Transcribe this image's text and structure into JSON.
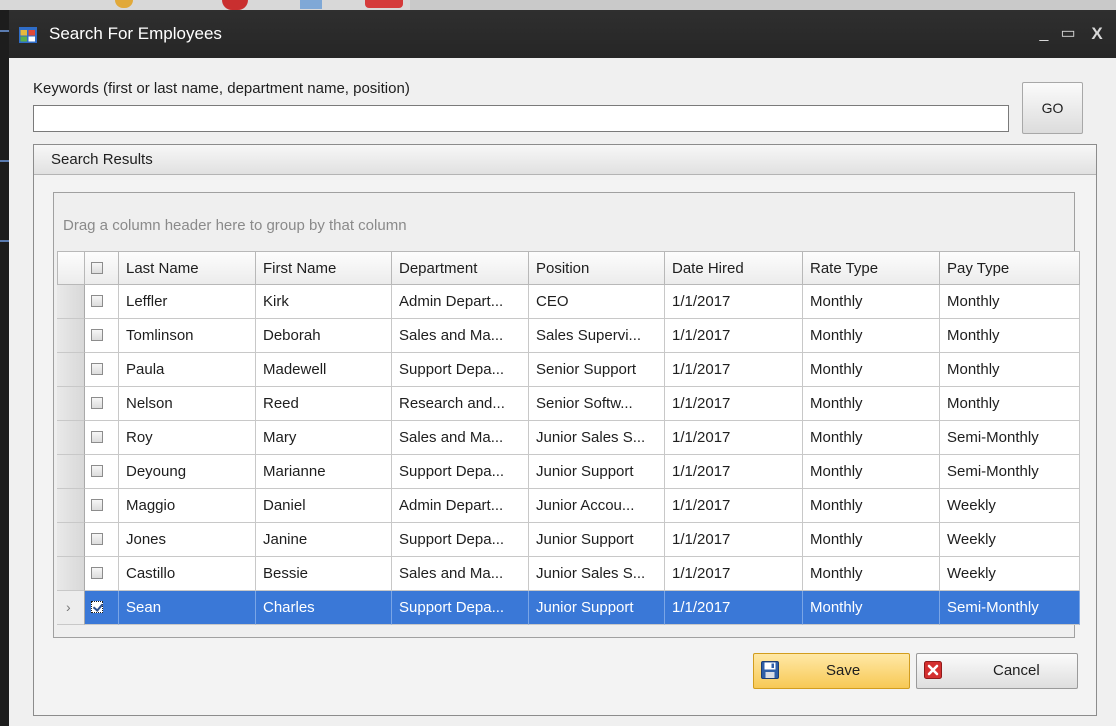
{
  "window": {
    "title": "Search For Employees",
    "controls": {
      "minimize": "_",
      "maximize": "▭",
      "close": "X"
    }
  },
  "search": {
    "label": "Keywords (first or last name, department name, position)",
    "value": "",
    "placeholder": "",
    "go_label": "GO"
  },
  "results": {
    "group_title": "Search Results",
    "group_hint": "Drag a column header here to group by that column",
    "columns": [
      "Last Name",
      "First Name",
      "Department",
      "Position",
      "Date Hired",
      "Rate Type",
      "Pay Type"
    ],
    "rows": [
      {
        "checked": false,
        "selected": false,
        "cells": [
          "Leffler",
          "Kirk",
          "Admin Depart...",
          "CEO",
          "1/1/2017",
          "Monthly",
          "Monthly"
        ]
      },
      {
        "checked": false,
        "selected": false,
        "cells": [
          "Tomlinson",
          "Deborah",
          "Sales and Ma...",
          "Sales Supervi...",
          "1/1/2017",
          "Monthly",
          "Monthly"
        ]
      },
      {
        "checked": false,
        "selected": false,
        "cells": [
          "Paula",
          "Madewell",
          "Support Depa...",
          "Senior Support",
          "1/1/2017",
          "Monthly",
          "Monthly"
        ]
      },
      {
        "checked": false,
        "selected": false,
        "cells": [
          "Nelson",
          "Reed",
          "Research and...",
          "Senior Softw...",
          "1/1/2017",
          "Monthly",
          "Monthly"
        ]
      },
      {
        "checked": false,
        "selected": false,
        "cells": [
          "Roy",
          "Mary",
          "Sales and Ma...",
          "Junior Sales S...",
          "1/1/2017",
          "Monthly",
          "Semi-Monthly"
        ]
      },
      {
        "checked": false,
        "selected": false,
        "cells": [
          "Deyoung",
          "Marianne",
          "Support Depa...",
          "Junior Support",
          "1/1/2017",
          "Monthly",
          "Semi-Monthly"
        ]
      },
      {
        "checked": false,
        "selected": false,
        "cells": [
          "Maggio",
          "Daniel",
          "Admin Depart...",
          "Junior Accou...",
          "1/1/2017",
          "Monthly",
          "Weekly"
        ]
      },
      {
        "checked": false,
        "selected": false,
        "cells": [
          "Jones",
          "Janine",
          "Support Depa...",
          "Junior Support",
          "1/1/2017",
          "Monthly",
          "Weekly"
        ]
      },
      {
        "checked": false,
        "selected": false,
        "cells": [
          "Castillo",
          "Bessie",
          "Sales and Ma...",
          "Junior Sales S...",
          "1/1/2017",
          "Monthly",
          "Weekly"
        ]
      },
      {
        "checked": true,
        "selected": true,
        "cells": [
          "Sean",
          "Charles",
          "Support Depa...",
          "Junior Support",
          "1/1/2017",
          "Monthly",
          "Semi-Monthly"
        ]
      }
    ]
  },
  "actions": {
    "save_label": "Save",
    "cancel_label": "Cancel",
    "save_icon": "floppy-disk-icon",
    "cancel_icon": "red-x-icon"
  },
  "colors": {
    "titlebar": "#2b2b2b",
    "selection": "#3a78d7",
    "save_button": "#f7c955",
    "cancel_icon": "#d42f2f"
  }
}
